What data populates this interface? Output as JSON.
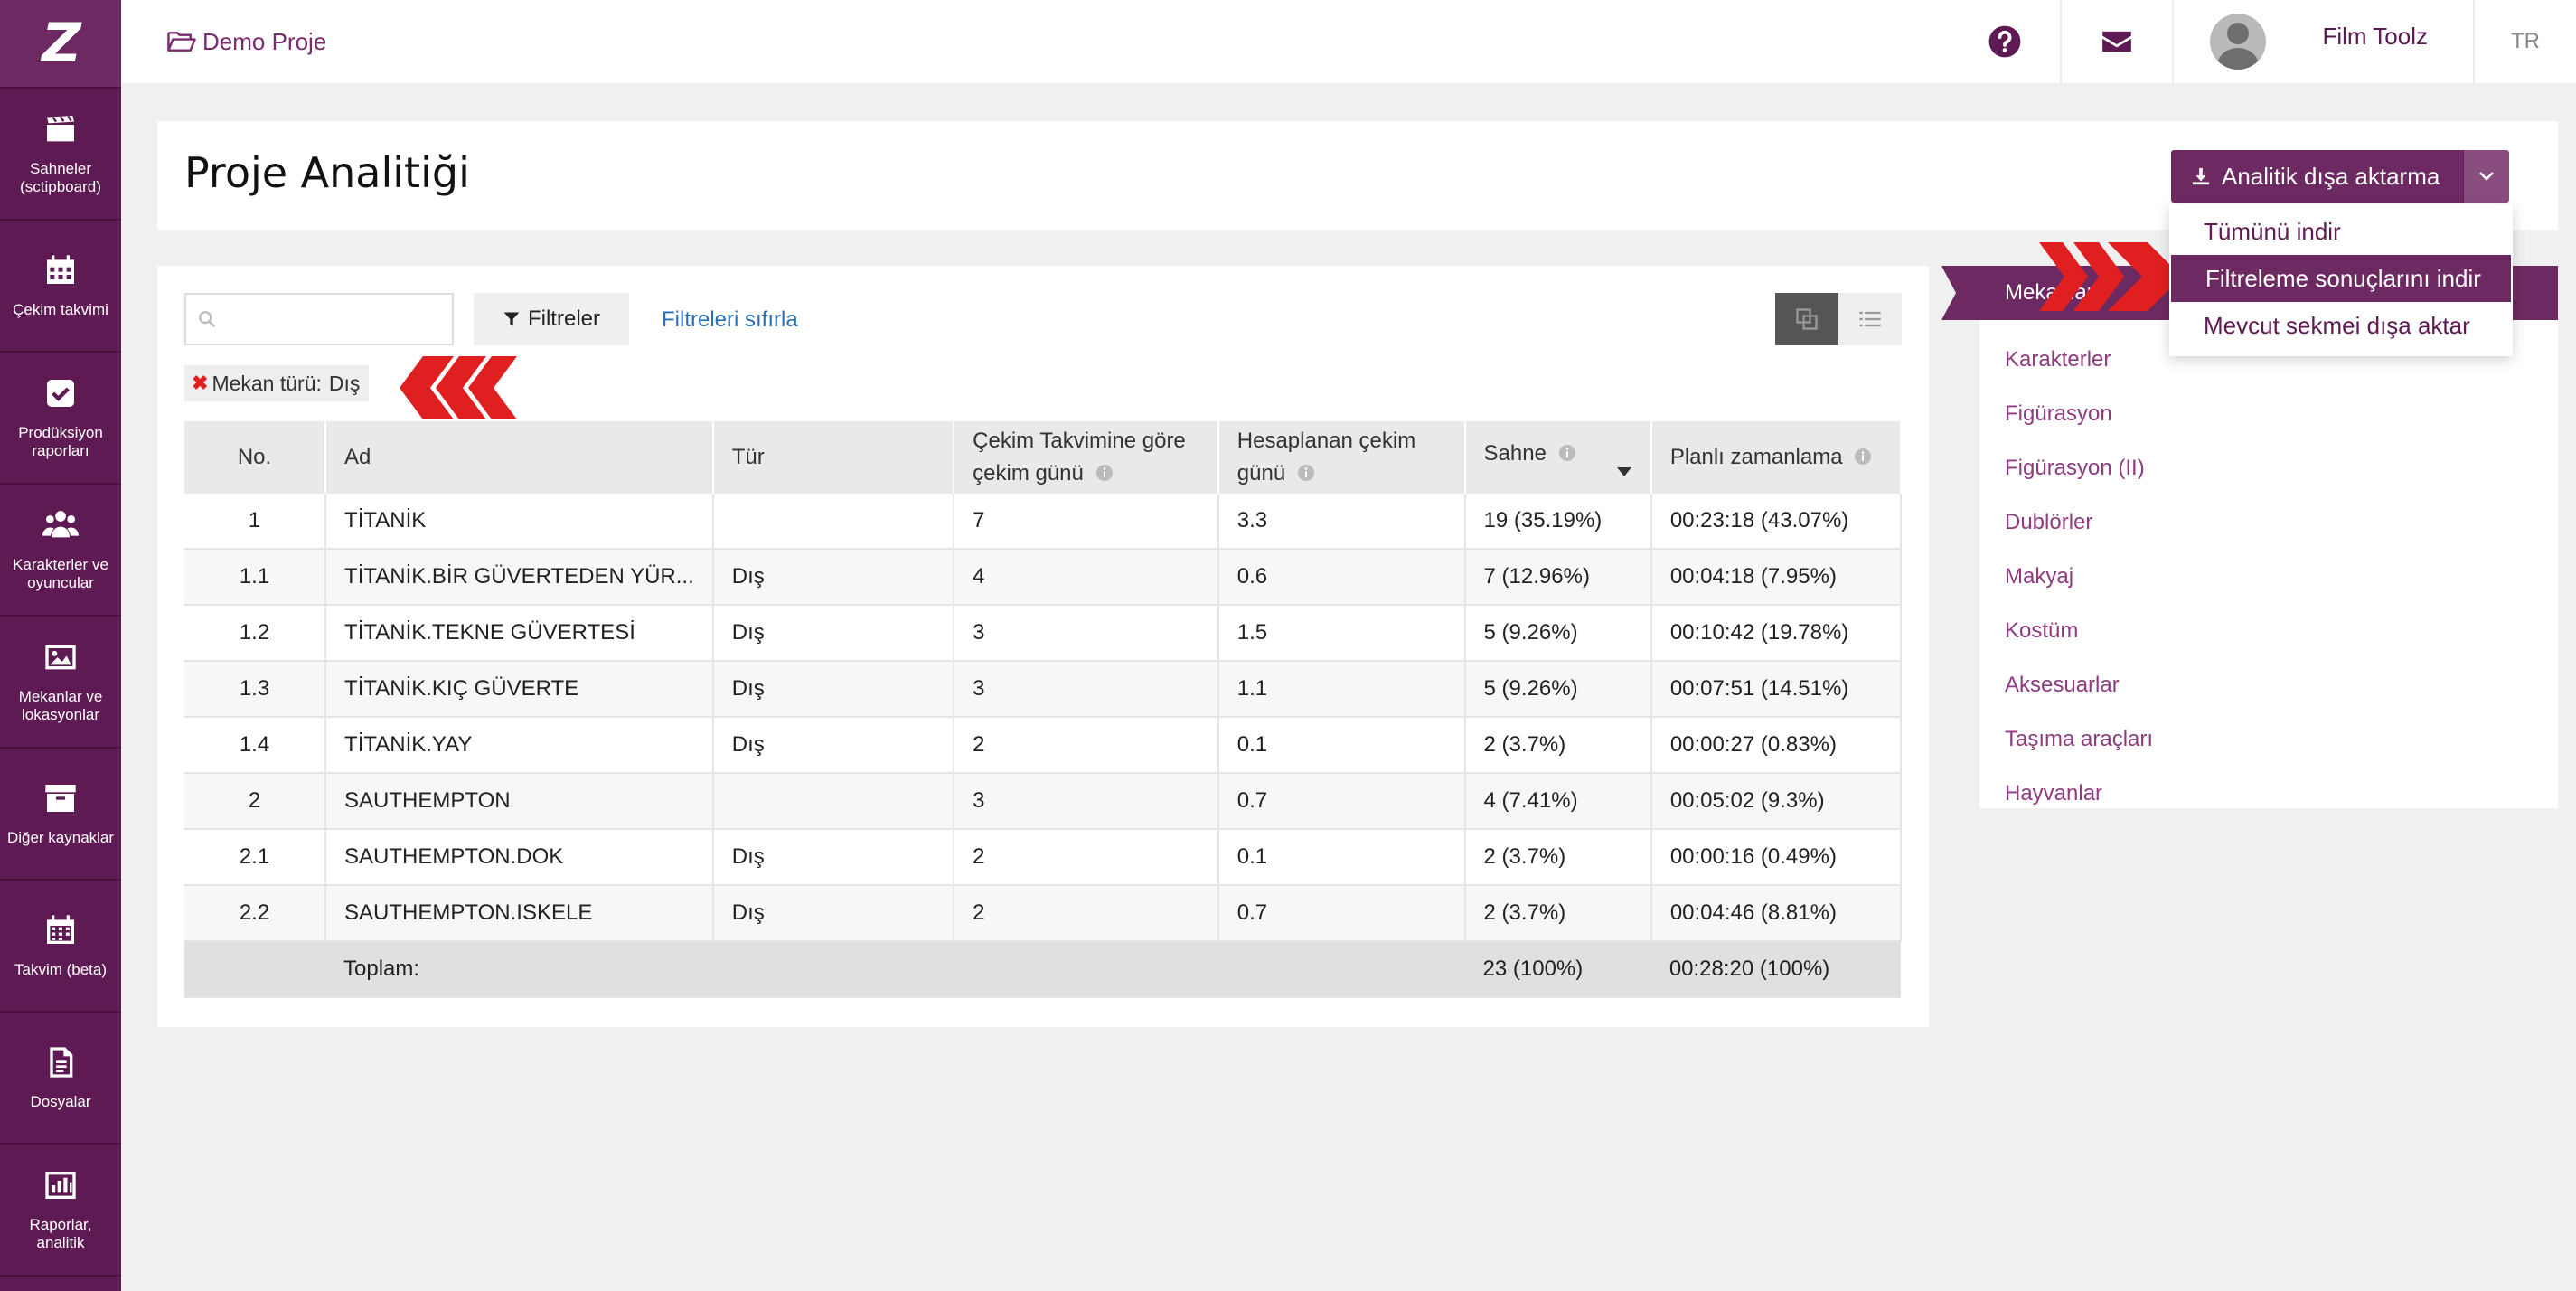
{
  "sidebar": {
    "logo": "Z",
    "items": [
      {
        "label": "Sahneler (sctipboard)",
        "icon": "clapperboard-icon"
      },
      {
        "label": "Çekim takvimi",
        "icon": "calendar-icon"
      },
      {
        "label": "Prodüksiyon raporları",
        "icon": "checkbox-icon"
      },
      {
        "label": "Karakterler ve oyuncular",
        "icon": "users-icon"
      },
      {
        "label": "Mekanlar ve lokasyonlar",
        "icon": "image-icon"
      },
      {
        "label": "Diğer kaynaklar",
        "icon": "archive-box-icon"
      },
      {
        "label": "Takvim (beta)",
        "icon": "calendar-grid-icon"
      },
      {
        "label": "Dosyalar",
        "icon": "document-icon"
      },
      {
        "label": "Raporlar, analitik",
        "icon": "bar-chart-icon"
      }
    ]
  },
  "header": {
    "breadcrumb": "Demo Proje",
    "user_name": "Film Toolz",
    "language": "TR"
  },
  "page": {
    "title": "Proje Analitiği",
    "export_label": "Analitik dışa aktarma",
    "export_menu": [
      "Tümünü indir",
      "Filtreleme sonuçlarını indir",
      "Mevcut sekmei dışa aktar"
    ]
  },
  "toolbar": {
    "search_placeholder": "",
    "filters_label": "Filtreler",
    "reset_label": "Filtreleri sıfırla"
  },
  "chip": {
    "label": "Mekan türü:",
    "value": "Dış"
  },
  "table": {
    "headers": {
      "no": "No.",
      "name": "Ad",
      "type": "Tür",
      "schedule_days_1": "Çekim Takvimine göre",
      "schedule_days_2": "çekim günü",
      "calc_days_1": "Hesaplanan çekim",
      "calc_days_2": "günü",
      "scene": "Sahne",
      "planned": "Planlı zamanlama"
    },
    "rows": [
      {
        "no": "1",
        "name": "TİTANİK",
        "type": "",
        "sched": "7",
        "calc": "3.3",
        "scene": "19 (35.19%)",
        "planned": "00:23:18 (43.07%)"
      },
      {
        "no": "1.1",
        "name": "TİTANİK.BİR GÜVERTEDEN YÜR...",
        "type": "Dış",
        "sched": "4",
        "calc": "0.6",
        "scene": "7 (12.96%)",
        "planned": "00:04:18 (7.95%)"
      },
      {
        "no": "1.2",
        "name": "TİTANİK.TEKNE GÜVERTESİ",
        "type": "Dış",
        "sched": "3",
        "calc": "1.5",
        "scene": "5 (9.26%)",
        "planned": "00:10:42 (19.78%)"
      },
      {
        "no": "1.3",
        "name": "TİTANİK.KIÇ GÜVERTE",
        "type": "Dış",
        "sched": "3",
        "calc": "1.1",
        "scene": "5 (9.26%)",
        "planned": "00:07:51 (14.51%)"
      },
      {
        "no": "1.4",
        "name": "TİTANİK.YAY",
        "type": "Dış",
        "sched": "2",
        "calc": "0.1",
        "scene": "2 (3.7%)",
        "planned": "00:00:27 (0.83%)"
      },
      {
        "no": "2",
        "name": "SAUTHEMPTON",
        "type": "",
        "sched": "3",
        "calc": "0.7",
        "scene": "4 (7.41%)",
        "planned": "00:05:02 (9.3%)"
      },
      {
        "no": "2.1",
        "name": "SAUTHEMPTON.DOK",
        "type": "Dış",
        "sched": "2",
        "calc": "0.1",
        "scene": "2 (3.7%)",
        "planned": "00:00:16 (0.49%)"
      },
      {
        "no": "2.2",
        "name": "SAUTHEMPTON.ISKELE",
        "type": "Dış",
        "sched": "2",
        "calc": "0.7",
        "scene": "2 (3.7%)",
        "planned": "00:04:46 (8.81%)"
      }
    ],
    "total": {
      "label": "Toplam:",
      "scene": "23 (100%)",
      "planned": "00:28:20 (100%)"
    }
  },
  "tabs": {
    "active": "Mekanlar",
    "items": [
      "Karakterler",
      "Figürasyon",
      "Figürasyon (II)",
      "Dublörler",
      "Makyaj",
      "Kostüm",
      "Aksesuarlar",
      "Taşıma araçları",
      "Hayvanlar"
    ]
  },
  "colors": {
    "brand": "#6d2a62",
    "sidebar": "#5e1a52",
    "link": "#2a6fb5",
    "annotation_arrow": "#e02020"
  }
}
